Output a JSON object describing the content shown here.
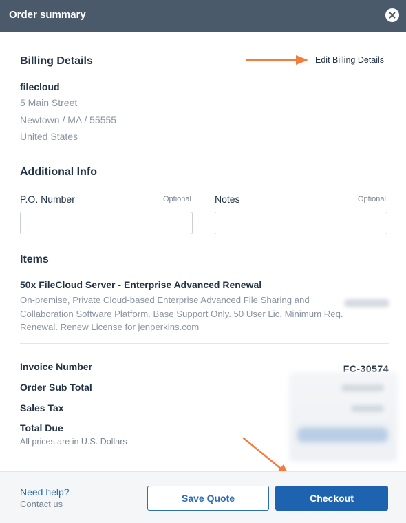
{
  "header": {
    "title": "Order summary",
    "close_icon": "close-icon"
  },
  "billing": {
    "section_title": "Billing Details",
    "edit_link": "Edit Billing Details",
    "company": "filecloud",
    "address_lines": [
      "5 Main Street",
      "Newtown / MA / 55555",
      "United States"
    ]
  },
  "additional_info": {
    "section_title": "Additional Info",
    "po_number": {
      "label": "P.O. Number",
      "optional": "Optional",
      "value": "",
      "placeholder": ""
    },
    "notes": {
      "label": "Notes",
      "optional": "Optional",
      "value": "",
      "placeholder": ""
    }
  },
  "items": {
    "section_title": "Items",
    "list": [
      {
        "name": "50x FileCloud Server - Enterprise Advanced Renewal",
        "description": "On-premise, Private Cloud-based Enterprise Advanced File Sharing and Collaboration Software Platform. Base Support Only. 50 User Lic. Minimum Req. Renewal. Renew License for jenperkins.com",
        "price_redacted": true
      }
    ]
  },
  "summary": {
    "invoice_label": "Invoice Number",
    "invoice_value": "FC-30574",
    "subtotal_label": "Order Sub Total",
    "tax_label": "Sales Tax",
    "total_label": "Total Due",
    "note": "All prices are in U.S. Dollars"
  },
  "footer": {
    "help_link": "Need help?",
    "contact": "Contact us",
    "save_quote": "Save Quote",
    "checkout": "Checkout"
  },
  "colors": {
    "header_bg": "#4a5a6a",
    "accent": "#1e63b0",
    "annotation_arrow": "#f47c3c",
    "muted_text": "#8a94a3"
  }
}
